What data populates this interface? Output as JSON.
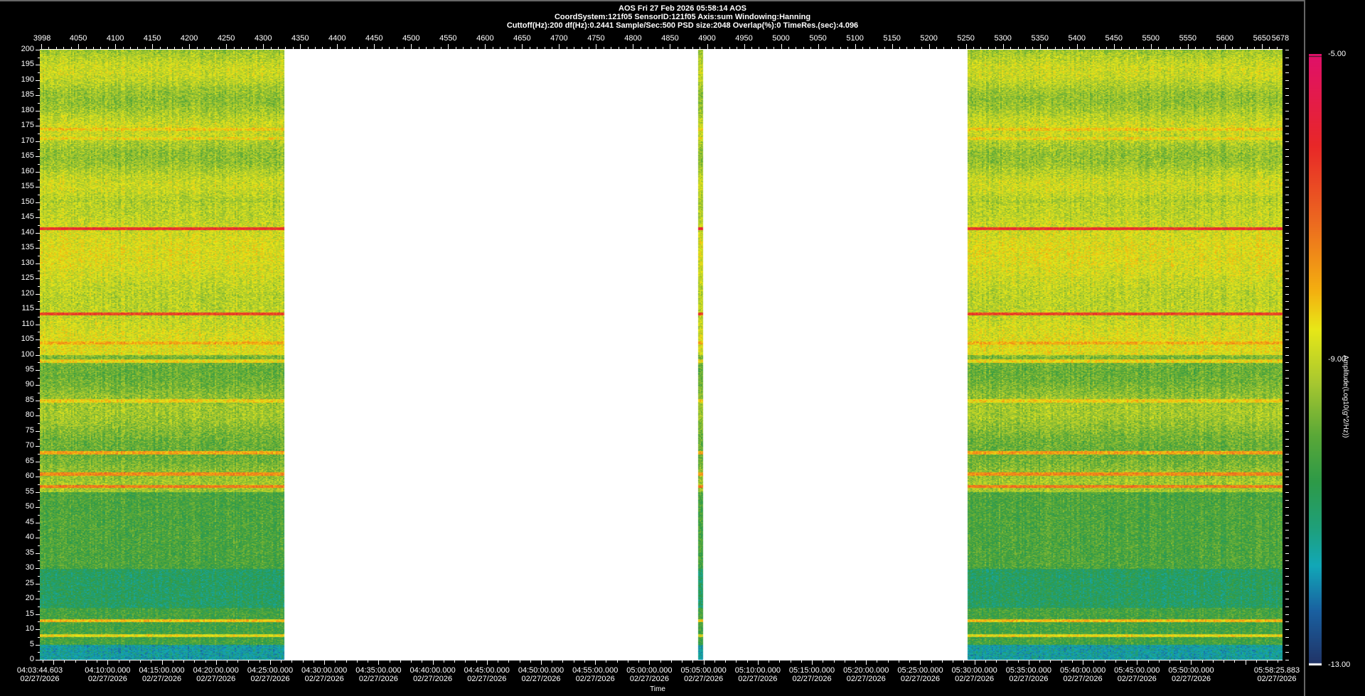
{
  "header": {
    "line1": "AOS  Fri 27 Feb 2026 05:58:14  AOS",
    "line2": "CoordSystem:121f05   SensorID:121f05   Axis:sum   Windowing:Hanning",
    "line3": "Cuttoff(Hz):200     df(Hz):0.2441     Sample/Sec:500     PSD size:2048     Overlap(%):0     TimeRes.(sec):4.096"
  },
  "chart_data": {
    "type": "heatmap",
    "title": "AOS  Fri 27 Feb 2026 05:58:14  AOS",
    "xlabel": "Time",
    "ylabel": "",
    "top_axis": {
      "range": [
        3998,
        5678
      ],
      "ticks": [
        4050,
        4100,
        4150,
        4200,
        4250,
        4300,
        4350,
        4400,
        4450,
        4500,
        4550,
        4600,
        4650,
        4700,
        4750,
        4800,
        4850,
        4900,
        4950,
        5000,
        5050,
        5100,
        5150,
        5200,
        5250,
        5300,
        5350,
        5400,
        5450,
        5500,
        5550,
        5600,
        5650
      ],
      "start_label": "3998",
      "end_label": "5678"
    },
    "y_axis": {
      "range": [
        0,
        200
      ],
      "step": 5
    },
    "time_axis": {
      "start": {
        "time": "04:03:44.603",
        "date": "02/27/2026"
      },
      "end": {
        "time": "05:58:25.883",
        "date": "02/27/2026"
      },
      "labels": [
        "04:10:00.000",
        "04:15:00.000",
        "04:20:00.000",
        "04:25:00.000",
        "04:30:00.000",
        "04:35:00.000",
        "04:40:00.000",
        "04:45:00.000",
        "04:50:00.000",
        "04:55:00.000",
        "05:00:00.000",
        "05:05:00.000",
        "05:10:00.000",
        "05:15:00.000",
        "05:20:00.000",
        "05:25:00.000",
        "05:30:00.000",
        "05:35:00.000",
        "05:40:00.000",
        "05:45:00.000",
        "05:50:00.000"
      ],
      "date": "02/27/2026"
    },
    "data_segments": [
      [
        3998,
        4329
      ],
      [
        4888,
        4895
      ],
      [
        5252,
        5678
      ]
    ],
    "bands_hz": [
      {
        "f": 141.5,
        "level": -6.3
      },
      {
        "f": 113.5,
        "level": -6.6
      },
      {
        "f": 57,
        "level": -7.4
      },
      {
        "f": 61,
        "level": -7.6
      },
      {
        "f": 68,
        "level": -7.9
      },
      {
        "f": 104,
        "level": -8.0
      },
      {
        "f": 174,
        "level": -8.3
      },
      {
        "f": 171,
        "level": -8.5
      },
      {
        "f": 85,
        "level": -8.4
      },
      {
        "f": 98,
        "level": -8.5
      },
      {
        "f": 13,
        "level": -8.2
      },
      {
        "f": 8,
        "level": -8.6
      }
    ],
    "colorbar": {
      "min": -13,
      "max": -5,
      "labels": [
        "-5.00",
        "-9.00",
        "-13.00"
      ],
      "title": "Amplitude(Log10(g^2/Hz))"
    }
  },
  "colors": {
    "background": "#000000",
    "text": "#ffffff"
  }
}
